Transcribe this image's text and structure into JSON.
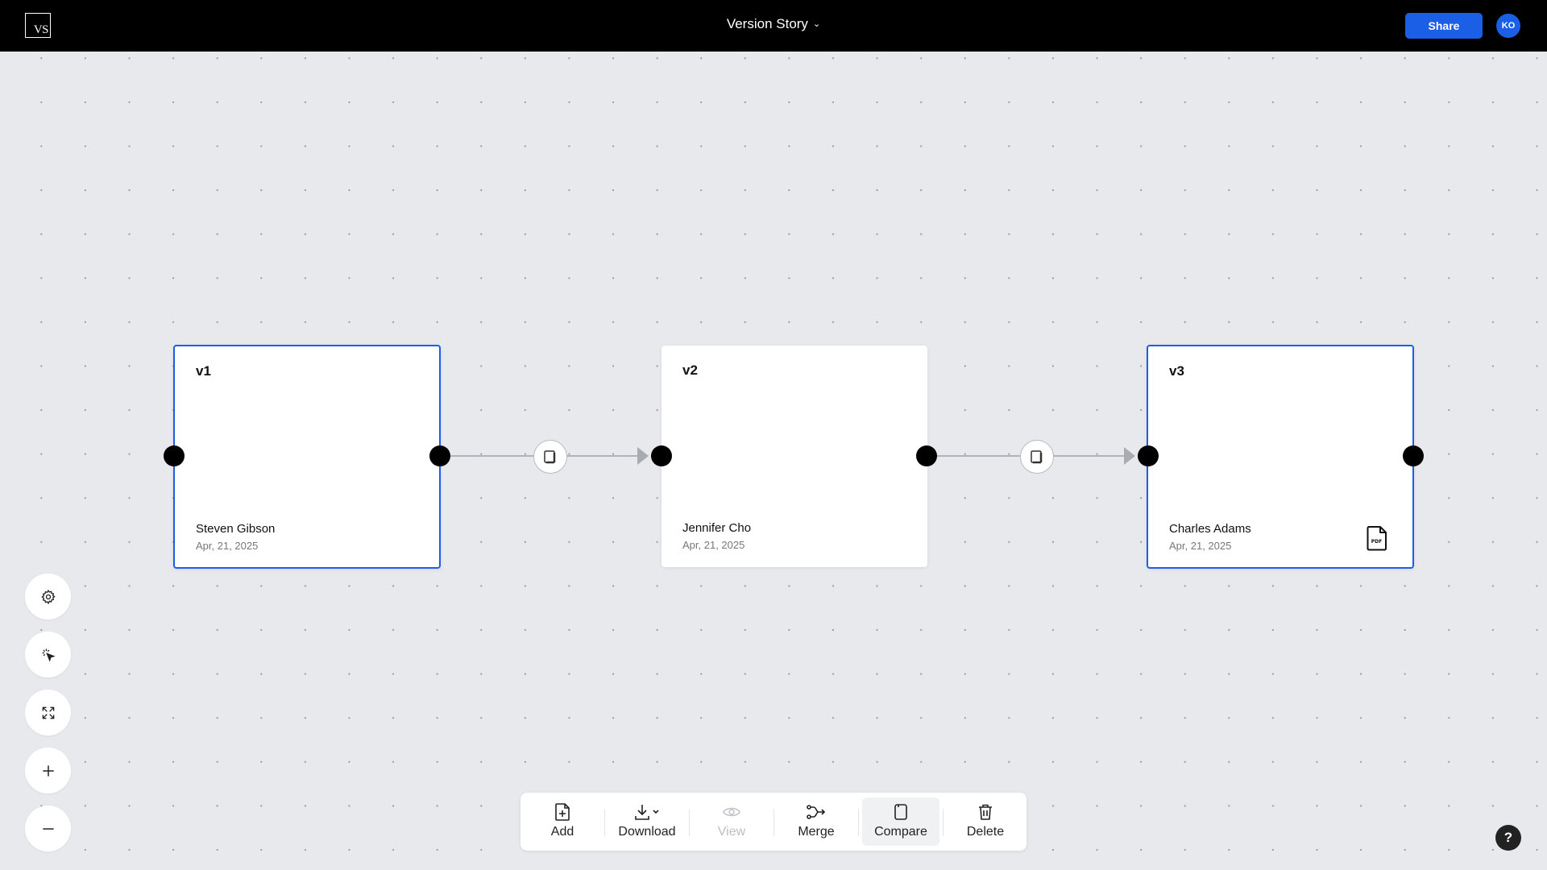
{
  "header": {
    "logo_text": "VS",
    "title": "Version Story",
    "share_label": "Share",
    "avatar_initials": "KO"
  },
  "versions": [
    {
      "label": "v1",
      "author": "Steven Gibson",
      "date": "Apr, 21, 2025",
      "selected": true,
      "has_pdf": false
    },
    {
      "label": "v2",
      "author": "Jennifer Cho",
      "date": "Apr, 21, 2025",
      "selected": false,
      "has_pdf": false
    },
    {
      "label": "v3",
      "author": "Charles Adams",
      "date": "Apr, 21, 2025",
      "selected": true,
      "has_pdf": true
    }
  ],
  "side_tools": [
    {
      "name": "settings-button",
      "icon": "gear-icon"
    },
    {
      "name": "select-tool-button",
      "icon": "cursor-click-icon"
    },
    {
      "name": "fit-to-screen-button",
      "icon": "expand-icon"
    },
    {
      "name": "zoom-in-button",
      "icon": "plus-icon"
    },
    {
      "name": "zoom-out-button",
      "icon": "minus-icon"
    }
  ],
  "toolbar": {
    "add_label": "Add",
    "download_label": "Download",
    "view_label": "View",
    "merge_label": "Merge",
    "compare_label": "Compare",
    "delete_label": "Delete"
  },
  "help_label": "?",
  "colors": {
    "accent": "#1a5fe6",
    "canvas": "#e8e9ec",
    "topbar": "#000000"
  }
}
